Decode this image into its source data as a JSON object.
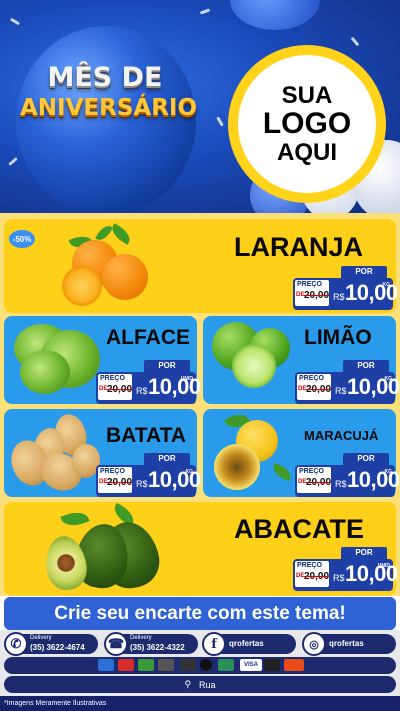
{
  "header": {
    "title_line1": "MÊS DE",
    "title_line2": "ANIVERSÁRIO",
    "logo_line1": "SUA",
    "logo_line2": "LOGO",
    "logo_line3": "AQUI"
  },
  "badge": "-50%",
  "products": [
    {
      "name": "LARANJA",
      "por": "POR",
      "preco": "PREÇO",
      "de": "DE",
      "old": "20,00",
      "currency": "R$",
      "price": "10,00",
      "unit": "KG"
    },
    {
      "name": "ALFACE",
      "por": "POR",
      "preco": "PREÇO",
      "de": "DE",
      "old": "20,00",
      "currency": "R$",
      "price": "10,00",
      "unit": "UNID"
    },
    {
      "name": "LIMÃO",
      "por": "POR",
      "preco": "PREÇO",
      "de": "DE",
      "old": "20,00",
      "currency": "R$",
      "price": "10,00",
      "unit": "KG"
    },
    {
      "name": "BATATA",
      "por": "POR",
      "preco": "PREÇO",
      "de": "DE",
      "old": "20,00",
      "currency": "R$",
      "price": "10,00",
      "unit": "KG"
    },
    {
      "name": "MARACUJÁ",
      "por": "POR",
      "preco": "PREÇO",
      "de": "DE",
      "old": "20,00",
      "currency": "R$",
      "price": "10,00",
      "unit": "KG"
    },
    {
      "name": "ABACATE",
      "por": "POR",
      "preco": "PREÇO",
      "de": "DE",
      "old": "20,00",
      "currency": "R$",
      "price": "10,00",
      "unit": "UNID"
    }
  ],
  "cta": "Crie seu encarte com este tema!",
  "footer": {
    "delivery1_label": "Delivery",
    "delivery1_phone": "(35) 3622-4674",
    "delivery2_label": "Delivery",
    "delivery2_phone": "(35) 3622-4322",
    "facebook": "qrofertas",
    "instagram": "qrofertas",
    "address": "Rua",
    "disclaimer": "*Imagens Meramente Ilustrativas"
  },
  "colors": {
    "header_blue": "#1a49b8",
    "card_yellow": "#ffd01a",
    "card_blue": "#2a9bea",
    "price_navy": "#1d3fa6",
    "footer_navy": "#1d2b6e"
  }
}
